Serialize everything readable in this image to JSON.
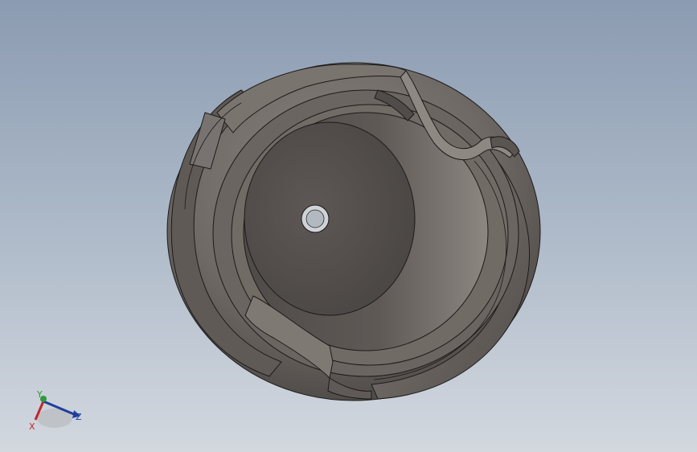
{
  "triad": {
    "x_label": "X",
    "y_label": "Y",
    "z_label": "Z",
    "x_color": "#c0262c",
    "y_color": "#2e9a3a",
    "z_color": "#1f3f9a"
  },
  "colors": {
    "background_top": "#8b9bb1",
    "background_bottom": "#d3d8df",
    "part_dark": "#4e4a47",
    "part_mid": "#6c6762",
    "part_light": "#8e8883",
    "edge": "#1c1a19"
  }
}
